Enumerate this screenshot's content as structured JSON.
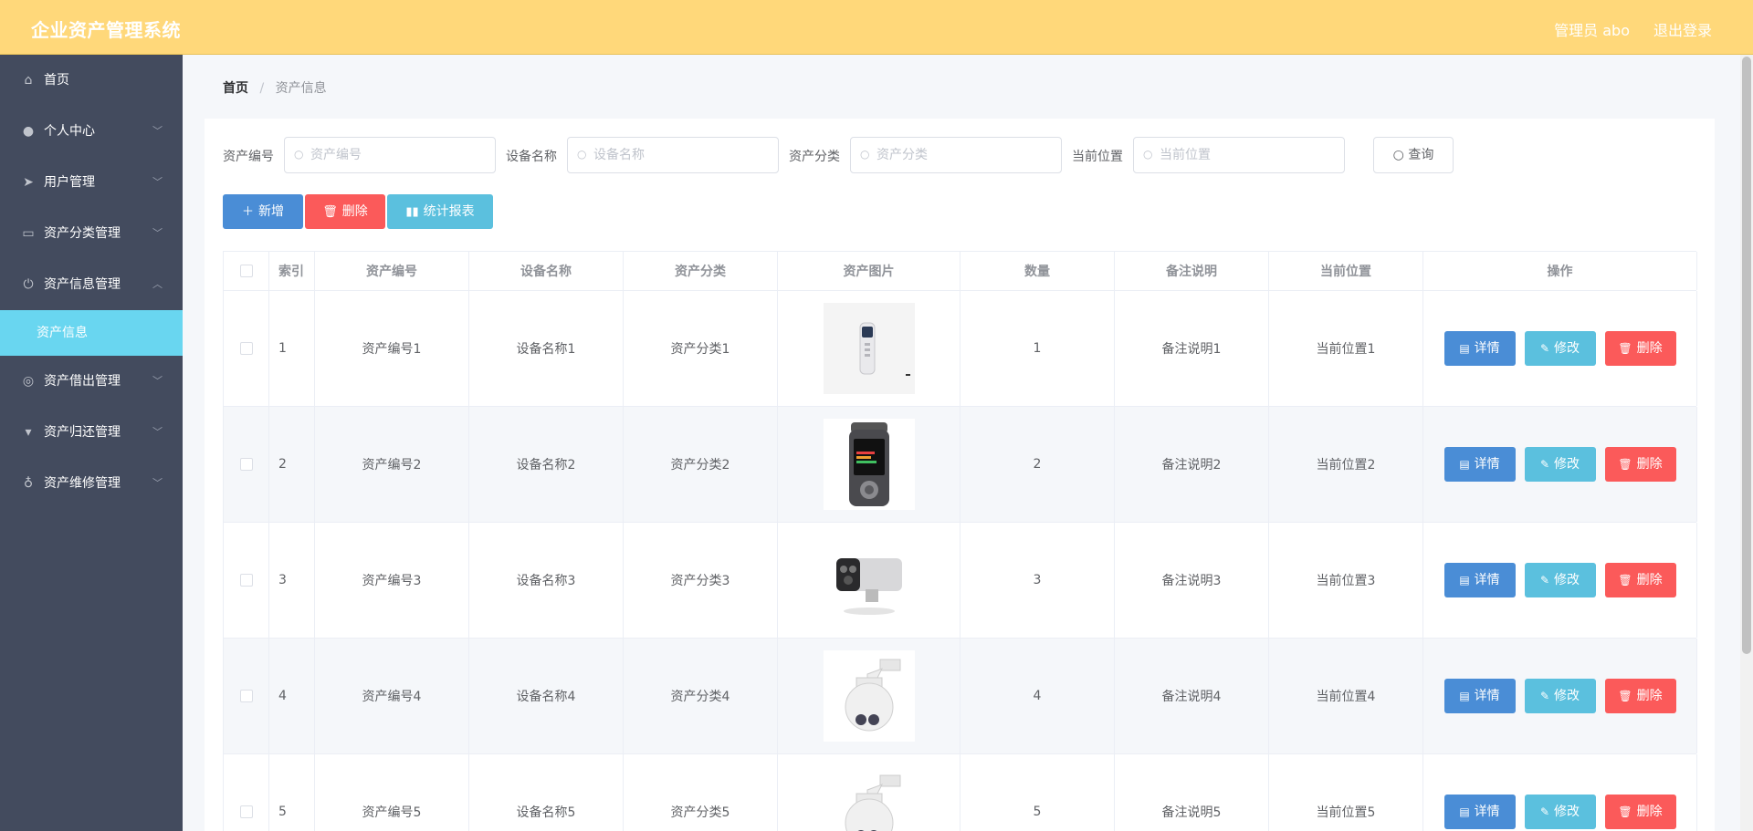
{
  "header": {
    "title": "企业资产管理系统",
    "user": "管理员 abo",
    "logout": "退出登录"
  },
  "sidebar": {
    "items": [
      {
        "label": "首页",
        "icon": "home-icon"
      },
      {
        "label": "个人中心",
        "icon": "user-icon"
      },
      {
        "label": "用户管理",
        "icon": "send-icon"
      },
      {
        "label": "资产分类管理",
        "icon": "id-card-icon"
      },
      {
        "label": "资产信息管理",
        "icon": "power-icon"
      },
      {
        "label": "资产信息",
        "icon": ""
      },
      {
        "label": "资产借出管理",
        "icon": "target-icon"
      },
      {
        "label": "资产归还管理",
        "icon": "stamp-icon"
      },
      {
        "label": "资产维修管理",
        "icon": "microphone-icon"
      }
    ]
  },
  "breadcrumb": {
    "home": "首页",
    "sep": "/",
    "current": "资产信息"
  },
  "search": {
    "asset_no_label": "资产编号",
    "asset_no_placeholder": "资产编号",
    "device_label": "设备名称",
    "device_placeholder": "设备名称",
    "category_label": "资产分类",
    "category_placeholder": "资产分类",
    "location_label": "当前位置",
    "location_placeholder": "当前位置",
    "query": "查询"
  },
  "toolbar": {
    "add": "新增",
    "delete": "删除",
    "report": "统计报表"
  },
  "table": {
    "headers": [
      "索引",
      "资产编号",
      "设备名称",
      "资产分类",
      "资产图片",
      "数量",
      "备注说明",
      "当前位置",
      "操作"
    ],
    "rows": [
      {
        "index": "1",
        "asset_no": "资产编号1",
        "device": "设备名称1",
        "category": "资产分类1",
        "image": "recorder-pen",
        "qty": "1",
        "note": "备注说明1",
        "location": "当前位置1"
      },
      {
        "index": "2",
        "asset_no": "资产编号2",
        "device": "设备名称2",
        "category": "资产分类2",
        "image": "audio-recorder",
        "qty": "2",
        "note": "备注说明2",
        "location": "当前位置2"
      },
      {
        "index": "3",
        "asset_no": "资产编号3",
        "device": "设备名称3",
        "category": "资产分类3",
        "image": "bullet-camera",
        "qty": "3",
        "note": "备注说明3",
        "location": "当前位置3"
      },
      {
        "index": "4",
        "asset_no": "资产编号4",
        "device": "设备名称4",
        "category": "资产分类4",
        "image": "dome-camera",
        "qty": "4",
        "note": "备注说明4",
        "location": "当前位置4"
      },
      {
        "index": "5",
        "asset_no": "资产编号5",
        "device": "设备名称5",
        "category": "资产分类5",
        "image": "dome-camera",
        "qty": "5",
        "note": "备注说明5",
        "location": "当前位置5"
      }
    ],
    "actions": {
      "detail": "详情",
      "edit": "修改",
      "delete": "删除"
    }
  },
  "colors": {
    "header": "#ffd87a",
    "sidebar": "#434b5e",
    "active": "#69d6f0",
    "primary": "#4a8dd6",
    "danger": "#fb5a5a",
    "info": "#5bc0de"
  }
}
